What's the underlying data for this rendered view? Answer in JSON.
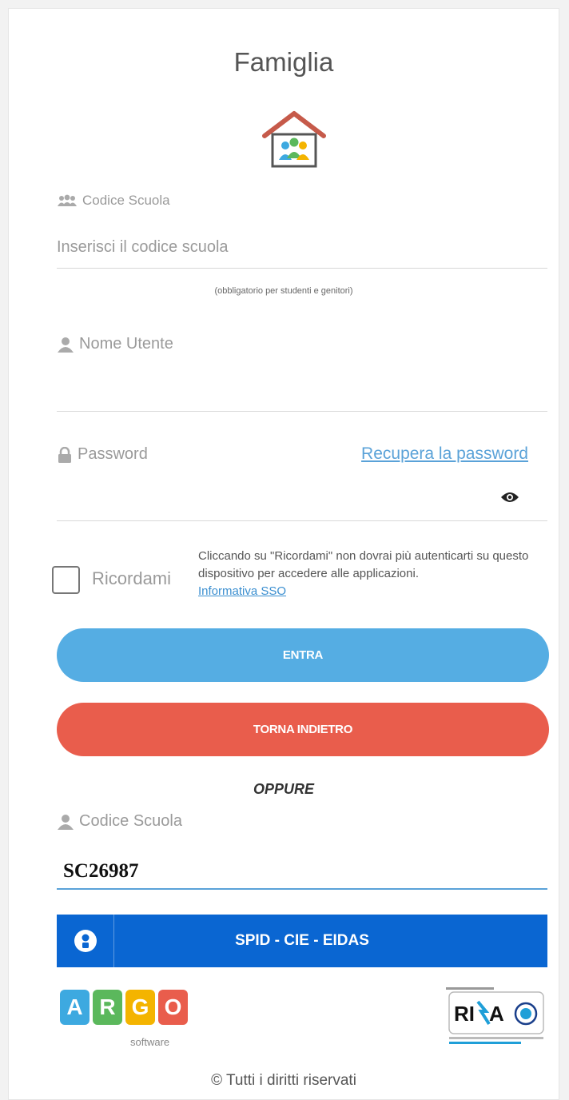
{
  "header": {
    "title": "Famiglia",
    "logo_icon": "house-family-icon"
  },
  "school_code_field": {
    "label": "Codice Scuola",
    "icon": "users-icon",
    "placeholder": "Inserisci il codice scuola",
    "value": "",
    "hint": "(obbligatorio per studenti e genitori)"
  },
  "username_field": {
    "label": "Nome Utente",
    "icon": "user-icon",
    "value": ""
  },
  "password_field": {
    "label": "Password",
    "icon": "lock-icon",
    "value": "",
    "recover_link": "Recupera la password",
    "toggle_icon": "eye-icon"
  },
  "remember": {
    "label": "Ricordami",
    "checked": false,
    "note": "Cliccando su \"Ricordami\" non dovrai più autenticarti su questo dispositivo per accedere alle applicazioni.",
    "link": "Informativa SSO"
  },
  "buttons": {
    "enter": "ENTRA",
    "back": "TORNA INDIETRO"
  },
  "separator": "OPPURE",
  "spid_section": {
    "label": "Codice Scuola",
    "icon": "user-icon",
    "value": "SC26987",
    "button_label": "SPID - CIE - EIDAS",
    "button_icon": "spid-user-icon"
  },
  "footer": {
    "argo_letters": [
      "A",
      "R",
      "G",
      "O"
    ],
    "argo_subtitle": "software",
    "argo_colors": [
      "#3da9e0",
      "#5bb85c",
      "#f4b400",
      "#e95d4c"
    ],
    "rina_text": "RINA",
    "copyright": "© Tutti i diritti riservati"
  },
  "colors": {
    "enter_button": "#55ade3",
    "back_button": "#e95d4c",
    "spid_button": "#0a66d2",
    "link": "#5aa2d8"
  }
}
